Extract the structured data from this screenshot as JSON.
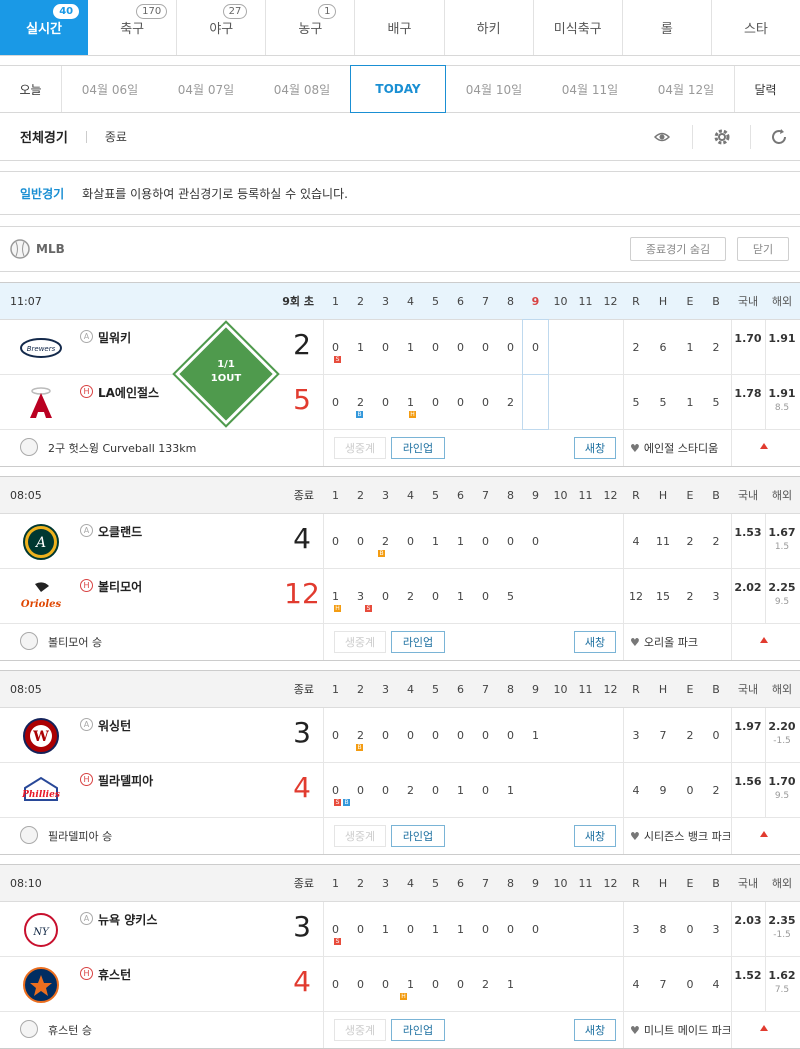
{
  "tabs": [
    {
      "label": "실시간",
      "count": "40"
    },
    {
      "label": "축구",
      "count": "170"
    },
    {
      "label": "야구",
      "count": "27"
    },
    {
      "label": "농구",
      "count": "1"
    },
    {
      "label": "배구",
      "count": ""
    },
    {
      "label": "하키",
      "count": ""
    },
    {
      "label": "미식축구",
      "count": ""
    },
    {
      "label": "롤",
      "count": ""
    },
    {
      "label": "스타",
      "count": ""
    }
  ],
  "dates": {
    "today_label": "오늘",
    "items": [
      "04월 06일",
      "04월 07일",
      "04월 08일",
      "TODAY",
      "04월 10일",
      "04월 11일",
      "04월 12일"
    ],
    "calendar": "달력"
  },
  "filter": {
    "all": "전체경기",
    "ended": "종료"
  },
  "notice": {
    "label": "일반경기",
    "text": "화살표를 이용하여 관심경기로 등록하실 수 있습니다."
  },
  "league": {
    "name": "MLB",
    "hide_btn": "종료경기 숨김",
    "close_btn": "닫기"
  },
  "header": {
    "innings": [
      "1",
      "2",
      "3",
      "4",
      "5",
      "6",
      "7",
      "8",
      "9",
      "10",
      "11",
      "12"
    ],
    "stats": [
      "R",
      "H",
      "E",
      "B"
    ],
    "dom": "국내",
    "abr": "해외"
  },
  "buttons": {
    "cast": "생중계",
    "lineup": "라인업",
    "new": "새창"
  },
  "games": [
    {
      "time": "11:07",
      "status": "9회 초",
      "live": true,
      "away": {
        "name": "밀워키",
        "score": "2",
        "innings": [
          "0",
          "1",
          "0",
          "1",
          "0",
          "0",
          "0",
          "0",
          "0",
          "",
          "",
          ""
        ],
        "stats": [
          "2",
          "6",
          "1",
          "2"
        ],
        "odd": "1.70",
        "odd_abr": "1.91",
        "odd_abr2": ""
      },
      "home": {
        "name": "LA에인절스",
        "score": "5",
        "innings": [
          "0",
          "2",
          "0",
          "1",
          "0",
          "0",
          "0",
          "2",
          "",
          "",
          "",
          ""
        ],
        "stats": [
          "5",
          "5",
          "1",
          "5"
        ],
        "odd": "1.78",
        "odd_abr": "1.91",
        "odd_abr2": "8.5"
      },
      "message": "2구 헛스윙 Curveball 133km",
      "stadium": "에인절 스타디움",
      "diamond": "1/1\n1OUT"
    },
    {
      "time": "08:05",
      "status": "종료",
      "live": false,
      "away": {
        "name": "오클랜드",
        "score": "4",
        "innings": [
          "0",
          "0",
          "2",
          "0",
          "1",
          "1",
          "0",
          "0",
          "0",
          "",
          "",
          ""
        ],
        "stats": [
          "4",
          "11",
          "2",
          "2"
        ],
        "odd": "1.53",
        "odd_abr": "1.67",
        "odd_abr2": "1.5"
      },
      "home": {
        "name": "볼티모어",
        "score": "12",
        "innings": [
          "1",
          "3",
          "0",
          "2",
          "0",
          "1",
          "0",
          "5",
          "",
          "",
          "",
          ""
        ],
        "stats": [
          "12",
          "15",
          "2",
          "3"
        ],
        "odd": "2.02",
        "odd_abr": "2.25",
        "odd_abr2": "9.5"
      },
      "message": "볼티모어 승",
      "stadium": "오리올 파크"
    },
    {
      "time": "08:05",
      "status": "종료",
      "live": false,
      "away": {
        "name": "워싱턴",
        "score": "3",
        "innings": [
          "0",
          "2",
          "0",
          "0",
          "0",
          "0",
          "0",
          "0",
          "1",
          "",
          "",
          ""
        ],
        "stats": [
          "3",
          "7",
          "2",
          "0"
        ],
        "odd": "1.97",
        "odd_abr": "2.20",
        "odd_abr2": "-1.5"
      },
      "home": {
        "name": "필라델피아",
        "score": "4",
        "innings": [
          "0",
          "0",
          "0",
          "2",
          "0",
          "1",
          "0",
          "1",
          "",
          "",
          "",
          ""
        ],
        "stats": [
          "4",
          "9",
          "0",
          "2"
        ],
        "odd": "1.56",
        "odd_abr": "1.70",
        "odd_abr2": "9.5"
      },
      "message": "필라델피아 승",
      "stadium": "시티즌스 뱅크 파크"
    },
    {
      "time": "08:10",
      "status": "종료",
      "live": false,
      "away": {
        "name": "뉴욕 양키스",
        "score": "3",
        "innings": [
          "0",
          "0",
          "1",
          "0",
          "1",
          "1",
          "0",
          "0",
          "0",
          "",
          "",
          ""
        ],
        "stats": [
          "3",
          "8",
          "0",
          "3"
        ],
        "odd": "2.03",
        "odd_abr": "2.35",
        "odd_abr2": "-1.5"
      },
      "home": {
        "name": "휴스턴",
        "score": "4",
        "innings": [
          "0",
          "0",
          "0",
          "1",
          "0",
          "0",
          "2",
          "1",
          "",
          "",
          "",
          ""
        ],
        "stats": [
          "4",
          "7",
          "0",
          "4"
        ],
        "odd": "1.52",
        "odd_abr": "1.62",
        "odd_abr2": "7.5"
      },
      "message": "휴스턴 승",
      "stadium": "미니트 메이드 파크"
    }
  ],
  "colors": {
    "accent": "#1a99e6",
    "win_score": "#e13b2f",
    "diamond": "#4f9a4d"
  }
}
